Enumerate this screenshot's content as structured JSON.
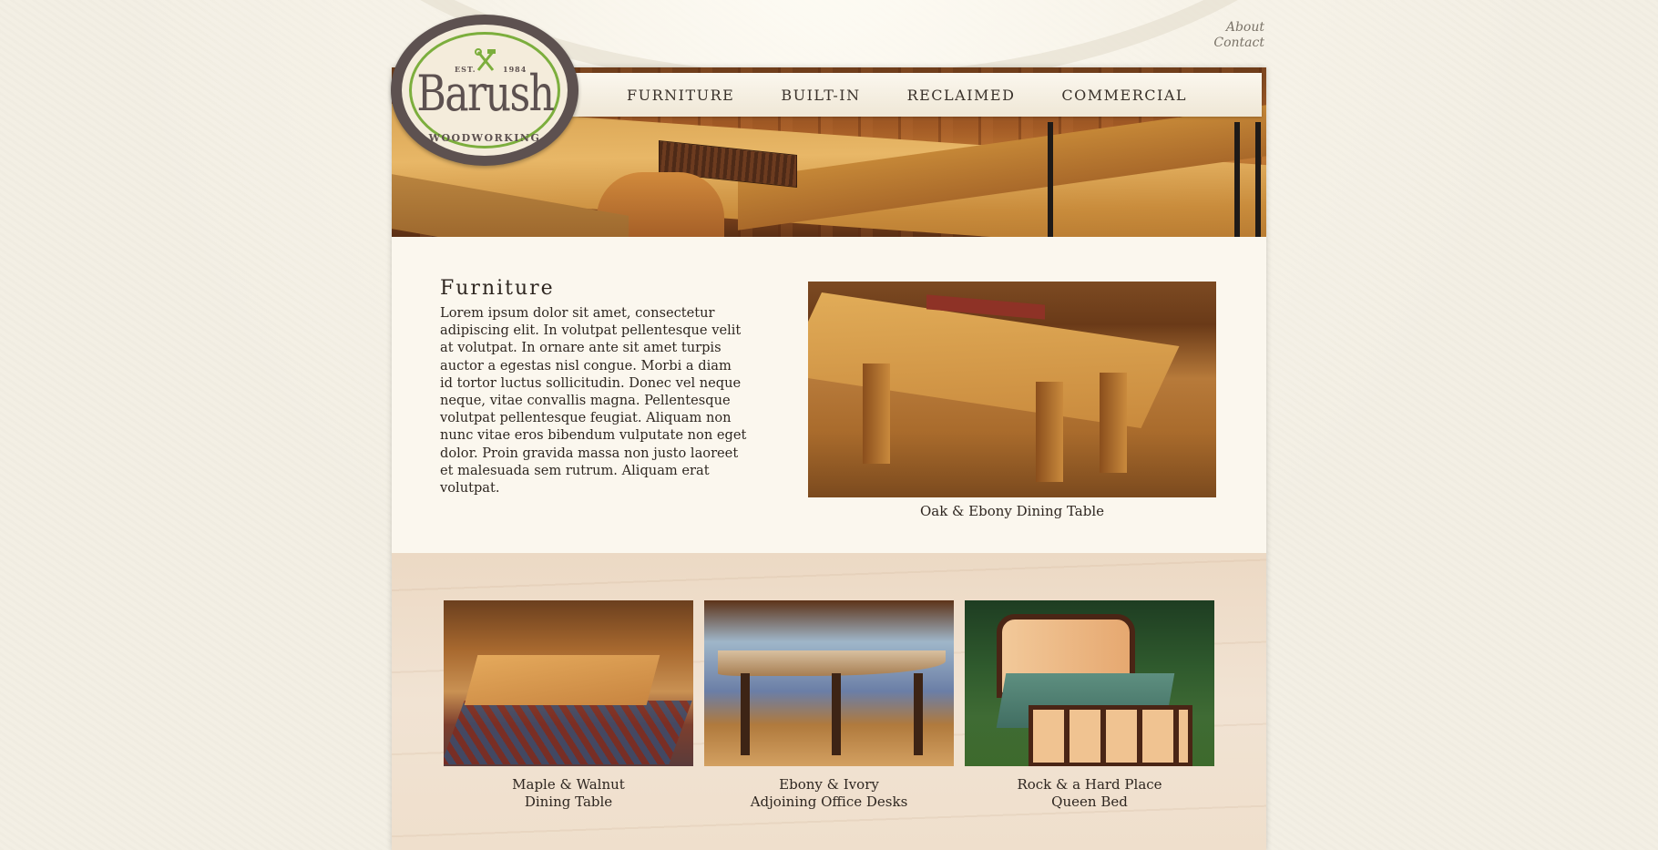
{
  "header": {
    "util_links": [
      "About",
      "Contact"
    ],
    "logo": {
      "est": "EST.",
      "year": "1984",
      "name": "Barush",
      "subtitle": "WOODWORKING"
    },
    "nav": [
      "FURNITURE",
      "BUILT-IN",
      "RECLAIMED",
      "COMMERCIAL"
    ]
  },
  "intro": {
    "title": "Furniture",
    "body": "Lorem ipsum dolor sit amet, consectetur adipiscing elit. In volutpat pellentesque velit at volutpat. In ornare ante sit amet turpis auctor a egestas nisl congue. Morbi a diam id tortor luctus sollicitudin. Donec vel neque neque, vitae convallis magna. Pellentesque volutpat pellentesque feugiat. Aliquam non nunc vitae eros bibendum vulputate non eget dolor. Proin gravida massa non justo laoreet et malesuada sem rutrum. Aliquam erat volutpat."
  },
  "feature": {
    "caption": "Oak & Ebony Dining Table"
  },
  "gallery": [
    {
      "line1": "Maple & Walnut",
      "line2": "Dining Table"
    },
    {
      "line1": "Ebony & Ivory",
      "line2": "Adjoining Office Desks"
    },
    {
      "line1": "Rock & a Hard Place",
      "line2": "Queen Bed"
    }
  ],
  "colors": {
    "accent_green": "#7cae3d",
    "logo_brown": "#5d5150",
    "text": "#2e2620",
    "page_bg": "#fbf7ee"
  }
}
